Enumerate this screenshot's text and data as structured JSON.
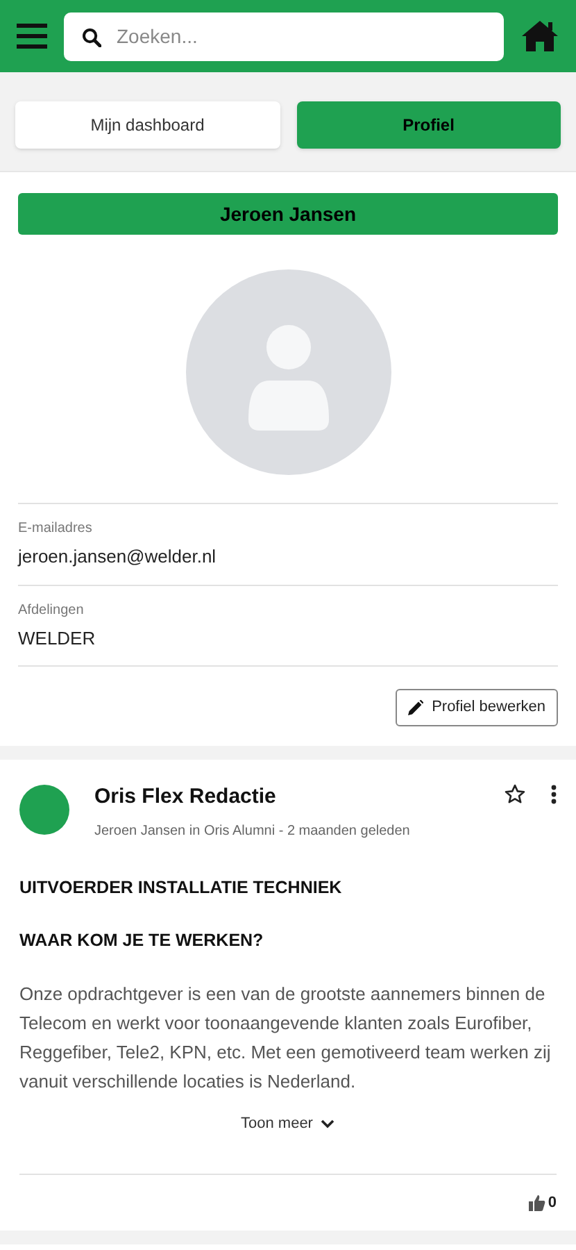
{
  "search": {
    "placeholder": "Zoeken..."
  },
  "tabs": [
    {
      "label": "Mijn dashboard",
      "selected": false
    },
    {
      "label": "Profiel",
      "selected": true
    }
  ],
  "profile": {
    "name": "Jeroen Jansen",
    "fields": [
      {
        "label": "E-mailadres",
        "value": "jeroen.jansen@welder.nl"
      },
      {
        "label": "Afdelingen",
        "value": "WELDER"
      }
    ],
    "edit_button": "Profiel bewerken"
  },
  "post": {
    "author": "Oris Flex Redactie",
    "meta": "Jeroen Jansen in Oris Alumni - 2 maanden geleden",
    "headings": [
      "UITVOERDER INSTALLATIE TECHNIEK",
      "WAAR KOM JE TE WERKEN?"
    ],
    "body": "Onze opdrachtgever is een van de grootste aannemers binnen de Telecom en werkt voor toonaangevende klanten zoals Eurofiber, Reggefiber, Tele2, KPN, etc. Met een gemotiveerd team werken zij vanuit verschillende locaties is Nederland.",
    "show_more": "Toon meer",
    "likes": "0"
  }
}
